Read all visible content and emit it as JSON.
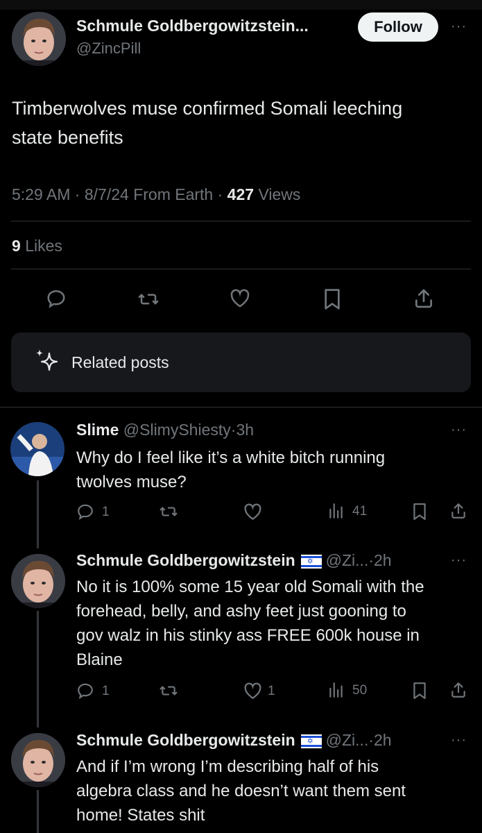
{
  "main_post": {
    "display_name": "Schmule Goldbergowitzstein...",
    "handle": "@ZincPill",
    "follow_label": "Follow",
    "more": "···",
    "text_line1": "Timberwolves muse confirmed Somali leeching",
    "text_line2": "state benefits",
    "time": "5:29 AM",
    "sep": "·",
    "date": "8/7/24",
    "location": "From Earth",
    "views_count": "427",
    "views_label": "Views",
    "likes_count": "9",
    "likes_label": "Likes"
  },
  "related": {
    "label": "Related posts"
  },
  "replies": [
    {
      "display_name": "Slime",
      "handle": "@SlimyShiesty",
      "time": "3h",
      "more": "···",
      "lines": [
        "Why do I feel like it’s a white bitch running",
        "twolves muse?"
      ],
      "reply_count": "1",
      "repost_count": "",
      "like_count": "",
      "view_count": "41"
    },
    {
      "display_name": "Schmule Goldbergowitzstein",
      "flag": "✡",
      "handle": "@Zi...",
      "time": "2h",
      "more": "···",
      "lines": [
        "No it is 100% some 15 year old Somali with the",
        "forehead, belly, and ashy feet just gooning to",
        "gov walz in his stinky ass FREE 600k house in",
        "Blaine"
      ],
      "reply_count": "1",
      "repost_count": "",
      "like_count": "1",
      "view_count": "50"
    },
    {
      "display_name": "Schmule Goldbergowitzstein",
      "flag": "✡",
      "handle": "@Zi...",
      "time": "2h",
      "more": "···",
      "lines": [
        "And if I’m wrong I’m describing half of his",
        "algebra class and he doesn’t want them sent",
        "home! States shit"
      ]
    }
  ],
  "colors": {
    "background": "#000000",
    "text": "#e7e9ea",
    "muted": "#71767b",
    "divider": "#2f3336",
    "card": "#16181c"
  }
}
